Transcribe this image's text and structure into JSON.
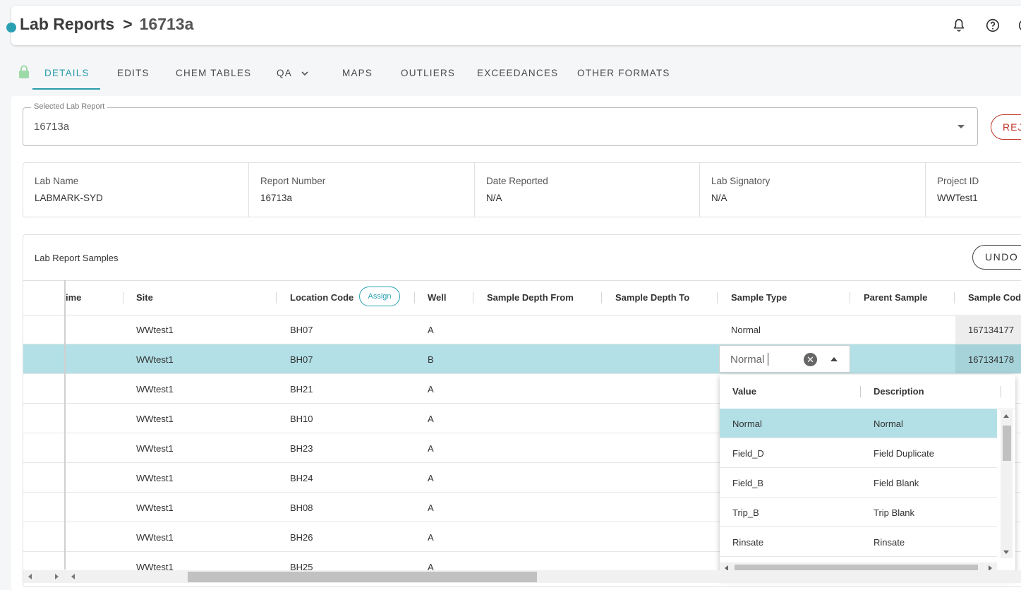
{
  "header": {
    "breadcrumb_root": "Lab Reports",
    "separator": ">",
    "breadcrumb_current": "16713a",
    "icons": [
      "bell-icon",
      "help-icon",
      "account-icon"
    ]
  },
  "tabs": [
    {
      "label": "DETAILS",
      "active": true
    },
    {
      "label": "EDITS"
    },
    {
      "label": "CHEM TABLES"
    },
    {
      "label": "QA"
    },
    {
      "label": "MAPS"
    },
    {
      "label": "OUTLIERS"
    },
    {
      "label": "EXCEEDANCES"
    },
    {
      "label": "OTHER FORMATS"
    }
  ],
  "report_select": {
    "legend": "Selected Lab Report",
    "value": "16713a",
    "reject_label": "REJ"
  },
  "info": [
    {
      "label": "Lab Name",
      "value": "LABMARK-SYD"
    },
    {
      "label": "Report Number",
      "value": "16713a"
    },
    {
      "label": "Date Reported",
      "value": "N/A"
    },
    {
      "label": "Lab Signatory",
      "value": "N/A"
    },
    {
      "label": "Project ID",
      "value": "WWTest1"
    }
  ],
  "samples": {
    "title": "Lab Report Samples",
    "undo_label": "UNDO",
    "assign_label": "Assign",
    "columns": [
      "ime",
      "Site",
      "Location Code",
      "Well",
      "Sample Depth From",
      "Sample Depth To",
      "Sample Type",
      "Parent Sample",
      "Sample Cod"
    ],
    "rows": [
      {
        "site": "WWtest1",
        "location": "BH07",
        "well": "A",
        "type": "Normal",
        "code": "167134177"
      },
      {
        "site": "WWtest1",
        "location": "BH07",
        "well": "B",
        "type": "",
        "code": "167134178"
      },
      {
        "site": "WWtest1",
        "location": "BH21",
        "well": "A",
        "type": "",
        "code": ""
      },
      {
        "site": "WWtest1",
        "location": "BH10",
        "well": "A",
        "type": "",
        "code": ""
      },
      {
        "site": "WWtest1",
        "location": "BH23",
        "well": "A",
        "type": "",
        "code": ""
      },
      {
        "site": "WWtest1",
        "location": "BH24",
        "well": "A",
        "type": "",
        "code": ""
      },
      {
        "site": "WWtest1",
        "location": "BH08",
        "well": "A",
        "type": "",
        "code": ""
      },
      {
        "site": "WWtest1",
        "location": "BH26",
        "well": "A",
        "type": "",
        "code": ""
      },
      {
        "site": "WWtest1",
        "location": "BH25",
        "well": "A",
        "type": "",
        "code": ""
      }
    ]
  },
  "editor": {
    "value": "Normal"
  },
  "dropdown": {
    "columns": [
      "Value",
      "Description"
    ],
    "options": [
      {
        "value": "Normal",
        "description": "Normal",
        "selected": true
      },
      {
        "value": "Field_D",
        "description": "Field Duplicate"
      },
      {
        "value": "Field_B",
        "description": "Field Blank"
      },
      {
        "value": "Trip_B",
        "description": "Trip Blank"
      },
      {
        "value": "Rinsate",
        "description": "Rinsate"
      }
    ]
  },
  "colors": {
    "accent": "#2a9cab",
    "selected_row": "#b2e0e6",
    "reject": "#c0392b"
  }
}
